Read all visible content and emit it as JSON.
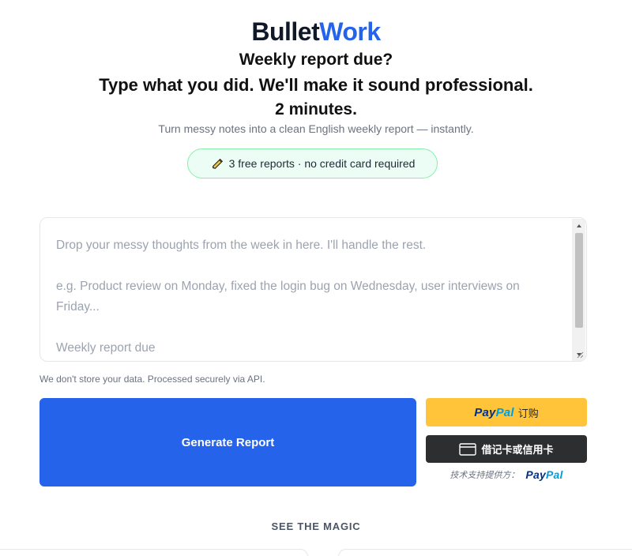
{
  "brand": {
    "part1": "Bullet",
    "part2": "Work",
    "color_primary": "#111827",
    "color_accent": "#2563eb"
  },
  "hero": {
    "line1": "Weekly report due?",
    "line2": "Type what you did. We'll make it sound professional.",
    "line3": "2 minutes.",
    "subtitle": "Turn messy notes into a clean English weekly report — instantly."
  },
  "badge": {
    "icon": "pencil-icon",
    "text": "3 free reports · no credit card required"
  },
  "editor": {
    "placeholder": "Drop your messy thoughts from the week in here. I'll handle the rest.\n\ne.g. Product review on Monday, fixed the login bug on Wednesday, user interviews on Friday...\n\nWeekly report due"
  },
  "privacy_note": "We don't store your data. Processed securely via API.",
  "actions": {
    "generate_label": "Generate Report",
    "paypal": {
      "word1": "Pay",
      "word2": "Pal",
      "label": "订购"
    },
    "card_label": "借记卡或信用卡",
    "powered_by": {
      "text": "技术支持提供方：",
      "word1": "Pay",
      "word2": "Pal"
    }
  },
  "section": {
    "see_magic": "SEE THE MAGIC"
  }
}
